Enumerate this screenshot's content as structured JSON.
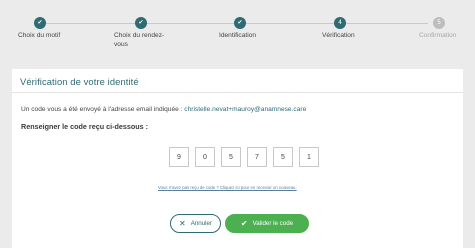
{
  "stepper": {
    "steps": [
      {
        "label": "Choix du motif",
        "status": "done"
      },
      {
        "label": "Choix du rendez-\nvous",
        "status": "done"
      },
      {
        "label": "Identification",
        "status": "done"
      },
      {
        "label": "Vérification",
        "status": "current",
        "number": "4"
      },
      {
        "label": "Confirmation",
        "status": "todo",
        "number": "5"
      }
    ],
    "colors": {
      "done": "#2e6b72",
      "todo": "#bdbdbd"
    }
  },
  "card": {
    "title": "Vérification de votre identité",
    "info_prefix": "Un code vous a été envoyé à l'adresse email indiquée :",
    "email": "christelle.nevat+mauroy@anamnese.care",
    "instruction": "Renseigner le code reçu ci-dessous :",
    "code_digits": [
      "9",
      "0",
      "5",
      "7",
      "5",
      "1"
    ],
    "resend_link": "Vous n'avez pas reçu de code ? Cliquez ici pour en recevoir un nouveau.",
    "cancel_label": "Annuler",
    "validate_label": "Valider le code",
    "accent_color": "#2e6b72",
    "validate_color": "#4caf50"
  }
}
